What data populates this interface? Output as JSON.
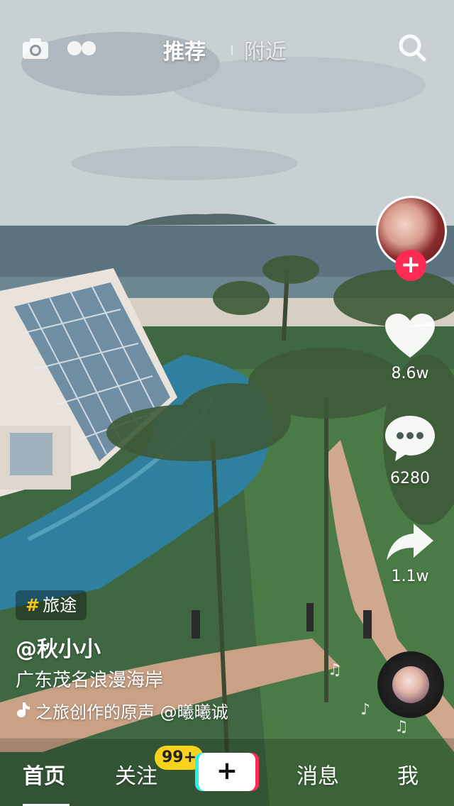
{
  "top_nav": {
    "tabs": [
      {
        "label": "推荐",
        "active": true
      },
      {
        "label": "附近",
        "active": false
      }
    ],
    "icons": [
      "camera-icon",
      "live-icon",
      "search-icon"
    ]
  },
  "sidebar_actions": {
    "likes": "8.6w",
    "comments": "6280",
    "shares": "1.1w"
  },
  "video_info": {
    "tag_symbol": "#",
    "tag": "旅途",
    "author": "@秋小小",
    "description": "广东茂名浪漫海岸",
    "music": "之旅创作的原声    @曦曦诚",
    "music_icon": "music-note-icon"
  },
  "bottom_nav": {
    "items": [
      {
        "label": "首页",
        "active": true
      },
      {
        "label": "关注",
        "active": false
      },
      {
        "label": "消息",
        "active": false
      },
      {
        "label": "我",
        "active": false
      }
    ],
    "follow_badge": "99+",
    "create_label": "+"
  },
  "colors": {
    "accent_red": "#fe2c55",
    "accent_cyan": "#25f4ee",
    "badge_yellow": "#f8d31d"
  }
}
